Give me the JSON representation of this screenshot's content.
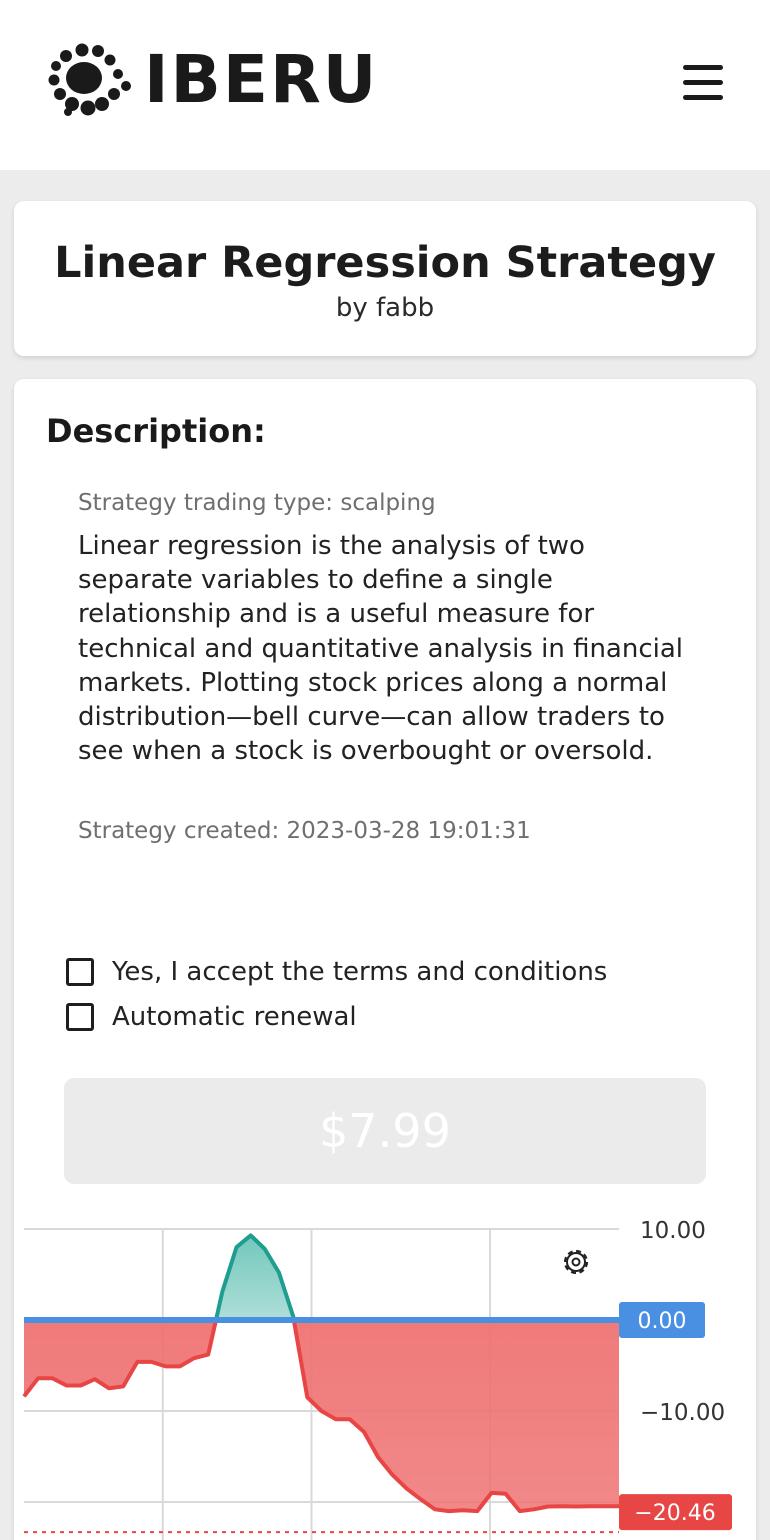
{
  "brand": {
    "name": "IBERU",
    "logo_icon": "dots-cluster-logo"
  },
  "header": {
    "menu_icon": "hamburger-menu-icon"
  },
  "strategy": {
    "title": "Linear Regression Strategy",
    "author": "by fabb",
    "description_heading": "Description:",
    "trading_type": "Strategy trading type: scalping",
    "description": "Linear regression is the analysis of two separate variables to define a single relationship and is a useful measure for technical and quantitative analysis in financial markets. Plotting stock prices along a normal distribution—bell curve—can allow traders to see when a stock is overbought or oversold.",
    "created": "Strategy created: 2023-03-28 19:01:31"
  },
  "form": {
    "accept_terms_label": "Yes, I accept the terms and conditions",
    "accept_terms_checked": false,
    "auto_renewal_label": "Automatic renewal",
    "auto_renewal_checked": false,
    "price_label": "$7.99"
  },
  "colors": {
    "positive_fill": "#6cc4b8",
    "positive_line": "#1f9d8f",
    "negative_fill": "#ef7373",
    "negative_line": "#e84545",
    "zero_line": "#4a90e2",
    "zero_badge": "#4a90e2",
    "last_badge": "#e84545"
  },
  "chart_data": {
    "type": "area",
    "y_ticks": [
      "10.00",
      "0.00",
      "−10.00",
      "−20.46"
    ],
    "ylim": [
      -22.5,
      10.5
    ],
    "zero_badge": "0.00",
    "last_value_badge": "−20.46",
    "last_value": -20.46,
    "grid": true,
    "settings_icon": "gear-icon",
    "x": [
      0,
      1,
      2,
      3,
      4,
      5,
      6,
      7,
      8,
      9,
      10,
      11,
      12,
      13,
      14,
      15,
      16,
      17,
      18,
      19,
      20,
      21,
      22,
      23,
      24,
      25,
      26,
      27,
      28,
      29,
      30,
      31,
      32,
      33,
      34,
      35,
      36,
      37,
      38,
      39,
      40,
      41,
      42
    ],
    "values": [
      -8.4,
      -6.4,
      -6.4,
      -7.2,
      -7.2,
      -6.5,
      -7.5,
      -7.3,
      -4.6,
      -4.6,
      -5.1,
      -5.1,
      -4.2,
      -3.8,
      3.1,
      8.0,
      9.3,
      7.8,
      5.2,
      0.4,
      -8.5,
      -10.0,
      -10.9,
      -10.9,
      -12.3,
      -15.1,
      -17.0,
      -18.5,
      -19.7,
      -20.8,
      -21.0,
      -20.9,
      -21.0,
      -19.0,
      -19.1,
      -21.0,
      -20.8,
      -20.5,
      -20.46,
      -20.5,
      -20.46,
      -20.46,
      -20.46
    ]
  }
}
